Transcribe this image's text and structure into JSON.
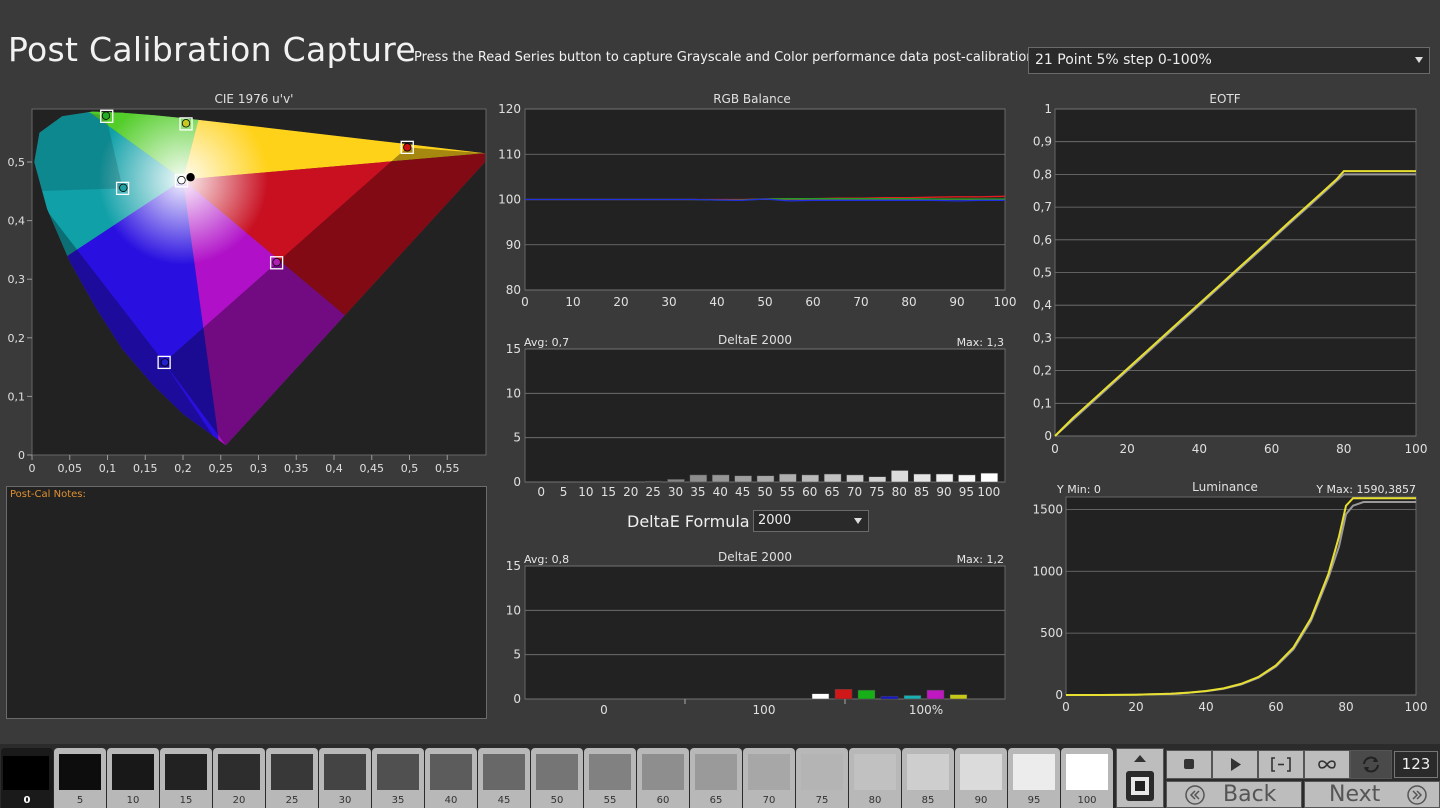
{
  "title": "Post Calibration Capture",
  "instructions": "Press the Read Series button to capture Grayscale and Color performance data post-calibration.",
  "series_select": {
    "value": "21 Point 5% step 0-100%"
  },
  "notes": {
    "label": "Post-Cal Notes:"
  },
  "formula": {
    "label": "DeltaE Formula",
    "value": "2000"
  },
  "counter": "123",
  "nav": {
    "back": "Back",
    "next": "Next"
  },
  "icons": [
    "stop-icon",
    "play-icon",
    "bracket-icon",
    "infinity-icon",
    "refresh-icon",
    "up-arrow-icon",
    "record-stop-icon",
    "double-chevron-left-icon",
    "double-chevron-right-icon"
  ],
  "swatches": [
    {
      "label": "0",
      "gray": "#000000",
      "active": true
    },
    {
      "label": "5",
      "gray": "#0d0d0d"
    },
    {
      "label": "10",
      "gray": "#181818"
    },
    {
      "label": "15",
      "gray": "#222222"
    },
    {
      "label": "20",
      "gray": "#2d2d2d"
    },
    {
      "label": "25",
      "gray": "#383838"
    },
    {
      "label": "30",
      "gray": "#444444"
    },
    {
      "label": "35",
      "gray": "#505050"
    },
    {
      "label": "40",
      "gray": "#5c5c5c"
    },
    {
      "label": "45",
      "gray": "#686868"
    },
    {
      "label": "50",
      "gray": "#757575"
    },
    {
      "label": "55",
      "gray": "#818181"
    },
    {
      "label": "60",
      "gray": "#8e8e8e"
    },
    {
      "label": "65",
      "gray": "#9a9a9a"
    },
    {
      "label": "70",
      "gray": "#a7a7a7"
    },
    {
      "label": "75",
      "gray": "#b4b4b4"
    },
    {
      "label": "80",
      "gray": "#c1c1c1"
    },
    {
      "label": "85",
      "gray": "#cecece"
    },
    {
      "label": "90",
      "gray": "#dbdbdb"
    },
    {
      "label": "95",
      "gray": "#ececec"
    },
    {
      "label": "100",
      "gray": "#ffffff"
    }
  ],
  "chart_data": [
    {
      "type": "scatter",
      "title": "CIE 1976 u'v'",
      "xlim": [
        0,
        0.6
      ],
      "ylim": [
        0,
        0.6
      ],
      "xticks": [
        "0",
        "0,05",
        "0,1",
        "0,15",
        "0,2",
        "0,25",
        "0,3",
        "0,35",
        "0,4",
        "0,45",
        "0,5",
        "0,55"
      ],
      "yticks": [
        "0",
        "0,1",
        "0,2",
        "0,3",
        "0,4",
        "0,5"
      ],
      "targets": [
        {
          "name": "red",
          "u": 0.497,
          "v": 0.525
        },
        {
          "name": "green",
          "u": 0.099,
          "v": 0.578
        },
        {
          "name": "blue",
          "u": 0.175,
          "v": 0.158
        },
        {
          "name": "cyan",
          "u": 0.12,
          "v": 0.455
        },
        {
          "name": "magenta",
          "u": 0.324,
          "v": 0.328
        },
        {
          "name": "yellow",
          "u": 0.204,
          "v": 0.565
        },
        {
          "name": "white",
          "u": 0.198,
          "v": 0.468
        }
      ],
      "measured": [
        {
          "name": "red",
          "u": 0.497,
          "v": 0.525,
          "color": "#cc1111"
        },
        {
          "name": "green",
          "u": 0.098,
          "v": 0.579,
          "color": "#22aa22"
        },
        {
          "name": "blue",
          "u": 0.176,
          "v": 0.158,
          "color": "#2222cc"
        },
        {
          "name": "cyan",
          "u": 0.121,
          "v": 0.456,
          "color": "#20a0a0"
        },
        {
          "name": "magenta",
          "u": 0.324,
          "v": 0.329,
          "color": "#b020b0"
        },
        {
          "name": "yellow",
          "u": 0.204,
          "v": 0.566,
          "color": "#c8c820"
        },
        {
          "name": "white",
          "u": 0.198,
          "v": 0.469,
          "color": "#ffffff"
        },
        {
          "name": "reference",
          "u": 0.21,
          "v": 0.474,
          "color": "#000000"
        }
      ]
    },
    {
      "type": "line",
      "title": "RGB Balance",
      "x": [
        0,
        5,
        10,
        15,
        20,
        25,
        30,
        35,
        40,
        45,
        50,
        55,
        60,
        65,
        70,
        75,
        80,
        85,
        90,
        95,
        100
      ],
      "xticks": [
        "0",
        "10",
        "20",
        "30",
        "40",
        "50",
        "60",
        "70",
        "80",
        "90",
        "100"
      ],
      "yticks": [
        "80",
        "90",
        "100",
        "110",
        "120"
      ],
      "xlim": [
        0,
        100
      ],
      "ylim": [
        80,
        120
      ],
      "series": [
        {
          "color": "#e02020",
          "values": [
            100,
            100,
            100,
            100,
            100,
            100,
            100,
            100,
            100,
            100,
            100.1,
            100.2,
            100.2,
            100.3,
            100.3,
            100.4,
            100.4,
            100.5,
            100.6,
            100.6,
            100.7
          ]
        },
        {
          "color": "#20a020",
          "values": [
            100,
            100,
            100,
            100,
            100,
            100,
            100,
            100,
            99.9,
            99.9,
            100.1,
            100.2,
            100.2,
            100.2,
            100.2,
            100.2,
            100.2,
            100.1,
            100.1,
            100.1,
            100.1
          ]
        },
        {
          "color": "#2030e0",
          "values": [
            100,
            100,
            100,
            100,
            100,
            100,
            100,
            100,
            99.9,
            99.8,
            100.1,
            99.7,
            99.8,
            99.8,
            99.8,
            99.8,
            99.8,
            99.8,
            99.7,
            99.8,
            99.8
          ]
        }
      ]
    },
    {
      "type": "bar",
      "title": "DeltaE 2000",
      "avg": "Avg: 0,7",
      "max": "Max: 1,3",
      "ylim": [
        0,
        15
      ],
      "yticks": [
        "0",
        "5",
        "10",
        "15"
      ],
      "categories": [
        "0",
        "5",
        "10",
        "15",
        "20",
        "25",
        "30",
        "35",
        "40",
        "45",
        "50",
        "55",
        "60",
        "65",
        "70",
        "75",
        "80",
        "85",
        "90",
        "95",
        "100"
      ],
      "values": [
        0,
        0,
        0,
        0,
        0,
        0.1,
        0.3,
        0.8,
        0.8,
        0.7,
        0.7,
        0.9,
        0.8,
        0.9,
        0.8,
        0.6,
        1.3,
        0.9,
        0.9,
        0.8,
        1.0
      ]
    },
    {
      "type": "bar",
      "title": "DeltaE 2000",
      "avg": "Avg: 0,8",
      "max": "Max: 1,2",
      "ylim": [
        0,
        15
      ],
      "yticks": [
        "0",
        "5",
        "10",
        "15"
      ],
      "group_labels": [
        "0",
        "100",
        "100%"
      ],
      "bars": [
        {
          "value": 0.6,
          "color": "#ffffff"
        },
        {
          "value": 1.1,
          "color": "#d01818"
        },
        {
          "value": 1.0,
          "color": "#18b018"
        },
        {
          "value": 0.3,
          "color": "#1818c8"
        },
        {
          "value": 0.4,
          "color": "#18b0b0"
        },
        {
          "value": 1.0,
          "color": "#c018c0"
        },
        {
          "value": 0.5,
          "color": "#c8c818"
        }
      ]
    },
    {
      "type": "line",
      "title": "EOTF",
      "xlim": [
        0,
        100
      ],
      "ylim": [
        0,
        1
      ],
      "xticks": [
        "0",
        "20",
        "40",
        "60",
        "80",
        "100"
      ],
      "yticks": [
        "0",
        "0,1",
        "0,2",
        "0,3",
        "0,4",
        "0,5",
        "0,6",
        "0,7",
        "0,8",
        "0,9",
        "1"
      ],
      "x": [
        0,
        5,
        10,
        15,
        20,
        25,
        30,
        35,
        40,
        45,
        50,
        55,
        60,
        65,
        70,
        75,
        78,
        80,
        85,
        90,
        95,
        100
      ],
      "series": [
        {
          "name": "target",
          "color": "#9a9a9a",
          "values": [
            0,
            0.05,
            0.1,
            0.15,
            0.2,
            0.25,
            0.3,
            0.35,
            0.4,
            0.45,
            0.5,
            0.55,
            0.6,
            0.65,
            0.7,
            0.75,
            0.78,
            0.8,
            0.8,
            0.8,
            0.8,
            0.8
          ]
        },
        {
          "name": "measured",
          "color": "#e8e030",
          "values": [
            0,
            0.055,
            0.105,
            0.155,
            0.205,
            0.255,
            0.305,
            0.355,
            0.405,
            0.455,
            0.505,
            0.555,
            0.605,
            0.655,
            0.705,
            0.755,
            0.785,
            0.81,
            0.81,
            0.81,
            0.81,
            0.81
          ]
        }
      ]
    },
    {
      "type": "line",
      "title": "Luminance",
      "ymin_label": "Y Min: 0",
      "ymax_label": "Y Max: 1590,3857",
      "xlim": [
        0,
        100
      ],
      "ylim": [
        0,
        1600
      ],
      "xticks": [
        "0",
        "20",
        "40",
        "60",
        "80",
        "100"
      ],
      "yticks": [
        "0",
        "500",
        "1000",
        "1500"
      ],
      "x": [
        0,
        10,
        20,
        30,
        35,
        40,
        45,
        50,
        55,
        60,
        65,
        70,
        75,
        78,
        80,
        82,
        85,
        90,
        95,
        100
      ],
      "series": [
        {
          "name": "target",
          "color": "#9a9a9a",
          "values": [
            0,
            0.3,
            2.4,
            10,
            18,
            30,
            50,
            85,
            140,
            230,
            370,
            600,
            950,
            1200,
            1460,
            1530,
            1560,
            1560,
            1560,
            1560
          ]
        },
        {
          "name": "measured",
          "color": "#e8e030",
          "values": [
            0,
            0.3,
            2.5,
            10,
            19,
            32,
            53,
            90,
            146,
            240,
            385,
            620,
            980,
            1280,
            1530,
            1590,
            1590,
            1590,
            1590,
            1590
          ]
        }
      ]
    }
  ]
}
